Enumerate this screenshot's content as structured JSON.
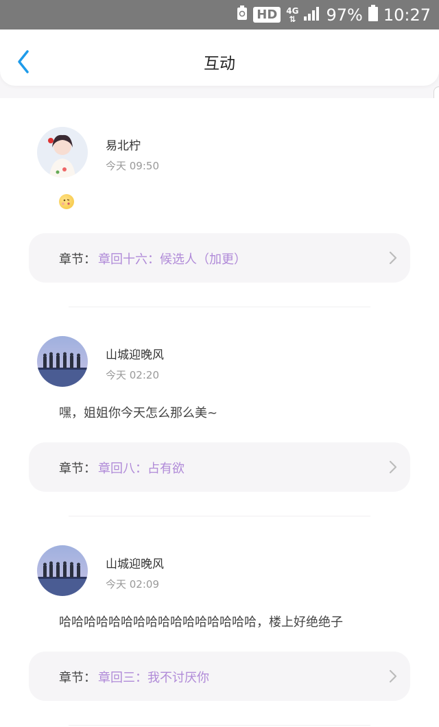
{
  "status_bar": {
    "hd": "HD",
    "network": "4G",
    "battery": "97%",
    "time": "10:27"
  },
  "header": {
    "title": "互动"
  },
  "comments": [
    {
      "user": "易北柠",
      "time": "今天 09:50",
      "message": "",
      "message_icon": "kiss-emoji",
      "chapter_label": "章节：",
      "chapter_title": "章回十六：候选人（加更）"
    },
    {
      "user": "山城迎晚风",
      "time": "今天 02:20",
      "message": "嘿，姐姐你今天怎么那么美~",
      "chapter_label": "章节：",
      "chapter_title": "章回八：占有欲"
    },
    {
      "user": "山城迎晚风",
      "time": "今天 02:09",
      "message": "哈哈哈哈哈哈哈哈哈哈哈哈哈哈哈哈，楼上好绝绝子",
      "chapter_label": "章节：",
      "chapter_title": "章回三：我不讨厌你"
    }
  ],
  "colors": {
    "accent": "#1e9bea",
    "chapter_link": "#b08ad8",
    "status_bar": "#7a7a7a"
  }
}
